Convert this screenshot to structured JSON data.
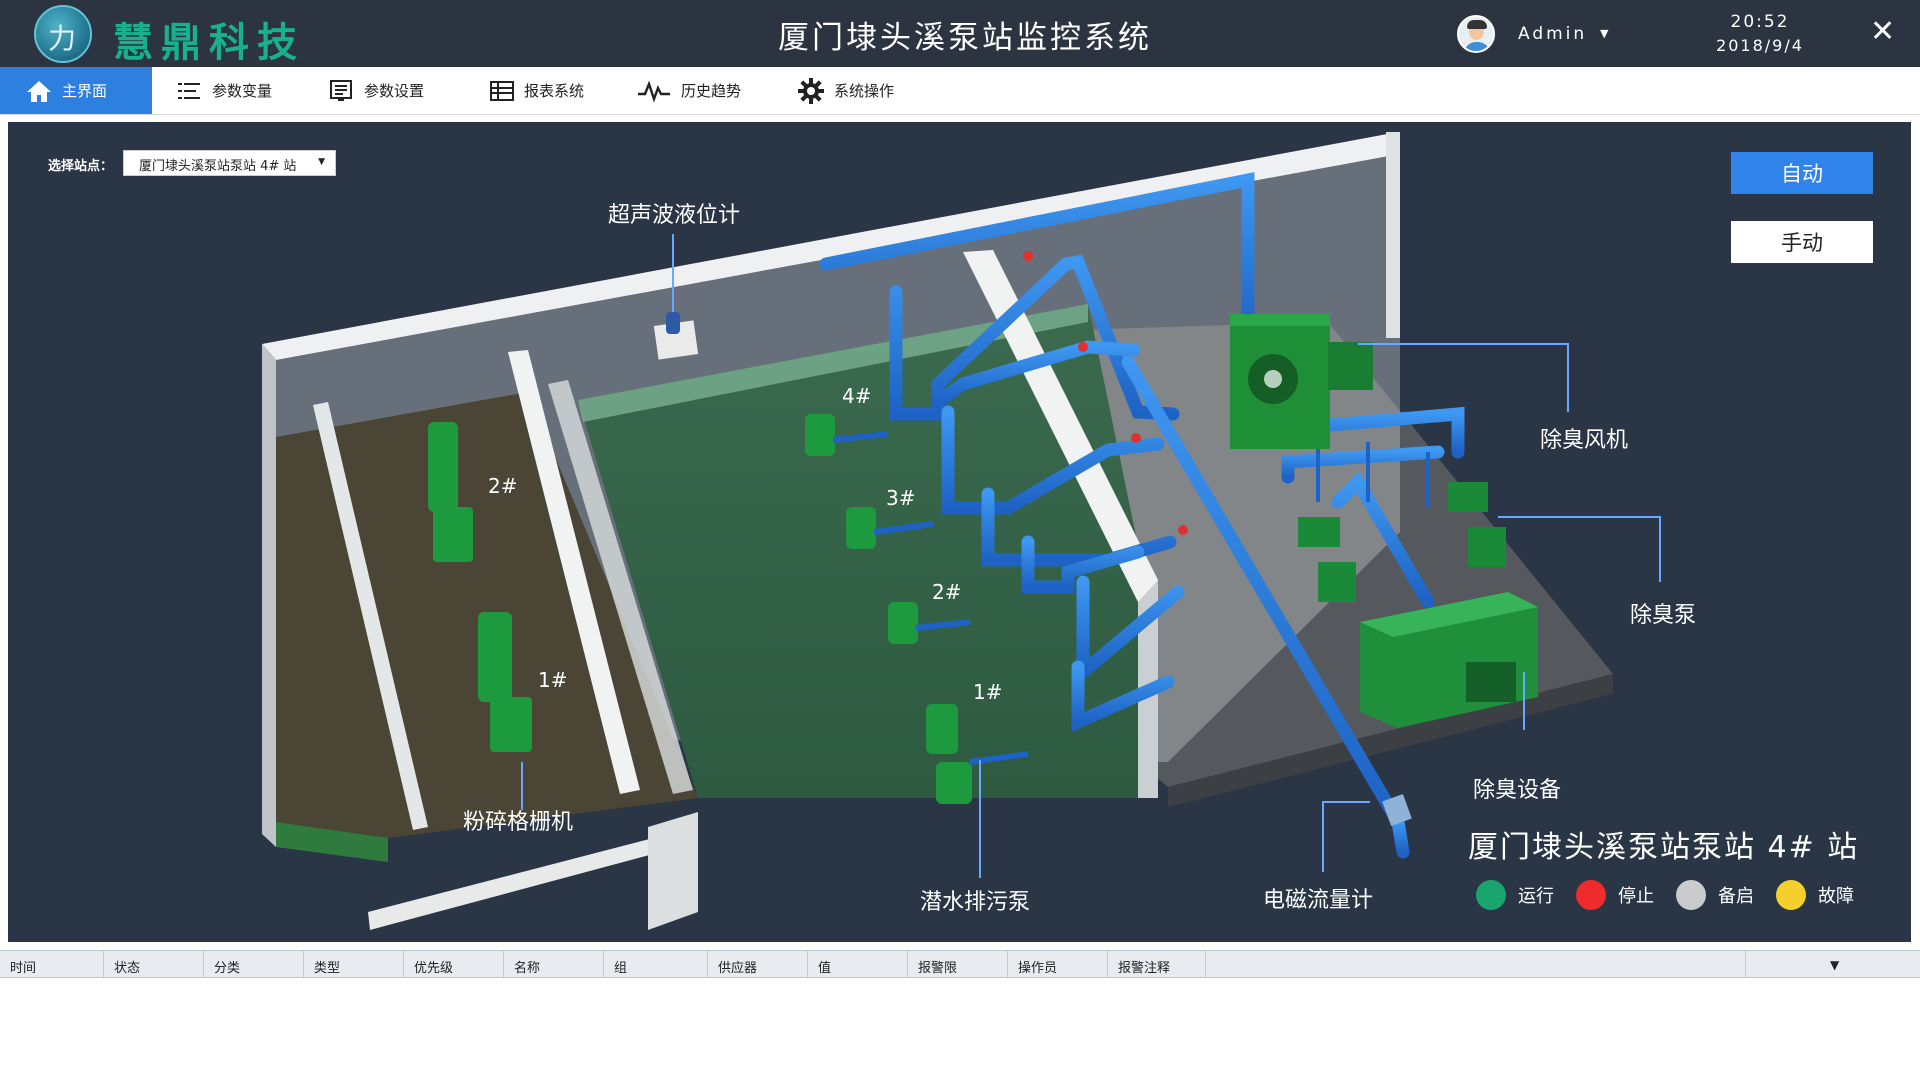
{
  "header": {
    "brand": "慧鼎科技",
    "logo_glyph": "力",
    "title": "厦门埭头溪泵站监控系统",
    "user": "Admin",
    "time": "20:52",
    "date": "2018/9/4"
  },
  "menu": {
    "items": [
      {
        "label": "主界面",
        "icon": "home-icon"
      },
      {
        "label": "参数变量",
        "icon": "list-icon"
      },
      {
        "label": "参数设置",
        "icon": "form-icon"
      },
      {
        "label": "报表系统",
        "icon": "table-icon"
      },
      {
        "label": "历史趋势",
        "icon": "trend-icon"
      },
      {
        "label": "系统操作",
        "icon": "gear-icon"
      }
    ],
    "active": "主界面"
  },
  "controls": {
    "station_label": "选择站点：",
    "station_value": "厦门埭头溪泵站泵站 4# 站",
    "auto": "自动",
    "manual": "手动"
  },
  "scene": {
    "callouts": {
      "level_meter": "超声波液位计",
      "fan": "除臭风机",
      "deodor_pump": "除臭泵",
      "deodor_device": "除臭设备",
      "flowmeter": "电磁流量计",
      "grinder": "粉碎格栅机",
      "sewage_pump": "潜水排污泵"
    },
    "grinder_labels": [
      "2#",
      "1#"
    ],
    "pump_labels": [
      "4#",
      "3#",
      "2#",
      "1#"
    ],
    "station_name": "厦门埭头溪泵站泵站 4# 站"
  },
  "legend": [
    {
      "label": "运行",
      "color": "#1aa56f"
    },
    {
      "label": "停止",
      "color": "#f02b2b"
    },
    {
      "label": "备启",
      "color": "#c9cbcc"
    },
    {
      "label": "故障",
      "color": "#f5cf2c"
    }
  ],
  "alarm_table": {
    "columns": [
      "时间",
      "状态",
      "分类",
      "类型",
      "优先级",
      "名称",
      "组",
      "供应器",
      "值",
      "报警限",
      "操作员",
      "报警注释"
    ]
  },
  "colors": {
    "header_bg": "#2c3442",
    "accent": "#2d7fe0",
    "brand": "#19b08d",
    "panel_bg": "#2a3546"
  }
}
